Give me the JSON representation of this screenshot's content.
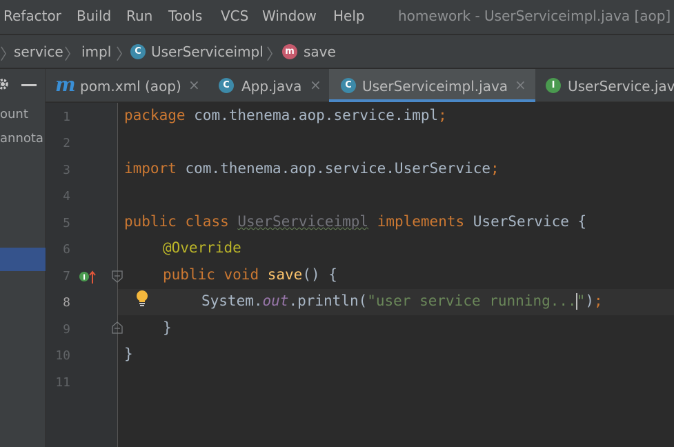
{
  "menu": {
    "items": [
      "Refactor",
      "Build",
      "Run",
      "Tools",
      "VCS",
      "Window",
      "Help"
    ],
    "window_title": "homework - UserServiceimpl.java [aop]"
  },
  "breadcrumb": {
    "items": [
      "service",
      "impl",
      "UserServiceimpl",
      "save"
    ],
    "class_badge": "C",
    "method_badge": "m"
  },
  "left_panel": {
    "lines": [
      "ount",
      "annota"
    ]
  },
  "tabs": [
    {
      "label": "pom.xml (aop)",
      "icon": "m",
      "active": false
    },
    {
      "label": "App.java",
      "icon": "C",
      "active": false
    },
    {
      "label": "UserServiceimpl.java",
      "icon": "C",
      "active": true
    },
    {
      "label": "UserService.java",
      "icon": "I",
      "active": false
    }
  ],
  "tab_close_glyph": "×",
  "editor": {
    "line_numbers": [
      "1",
      "2",
      "3",
      "4",
      "5",
      "6",
      "7",
      "8",
      "9",
      "10",
      "11"
    ],
    "current_line": "8",
    "code": {
      "l1_kw": "package",
      "l1_rest": " com.thenema.aop.service.impl",
      "l1_semi": ";",
      "l3_kw": "import",
      "l3_rest": " com.thenema.aop.service.UserService",
      "l3_semi": ";",
      "l5_kw1": "public",
      "l5_kw2": "class",
      "l5_cls": "UserServiceimpl",
      "l5_kw3": "implements",
      "l5_rest": " UserService {",
      "l6_ann": "@Override",
      "l7_kw1": "public",
      "l7_kw2": "void",
      "l7_fn": "save",
      "l7_rest": "() {",
      "l8_obj": "System.",
      "l8_fld": "out",
      "l8_call": ".println(",
      "l8_str_a": "\"user service running...",
      "l8_str_b": "\"",
      "l8_end": ")",
      "l8_semi": ";",
      "l9": "}",
      "l10": "}"
    }
  },
  "colors": {
    "keyword": "#cc7832",
    "annotation": "#bbb529",
    "method": "#ffc66d",
    "string": "#6a8759",
    "field": "#9876aa",
    "plain": "#a9b7c6",
    "tab_underline": "#4a88c7"
  },
  "icons": [
    "maven-icon",
    "class-icon",
    "interface-icon",
    "method-icon",
    "lightbulb-icon",
    "implements-marker-icon",
    "fold-icon",
    "settings-icon",
    "collapse-icon"
  ]
}
